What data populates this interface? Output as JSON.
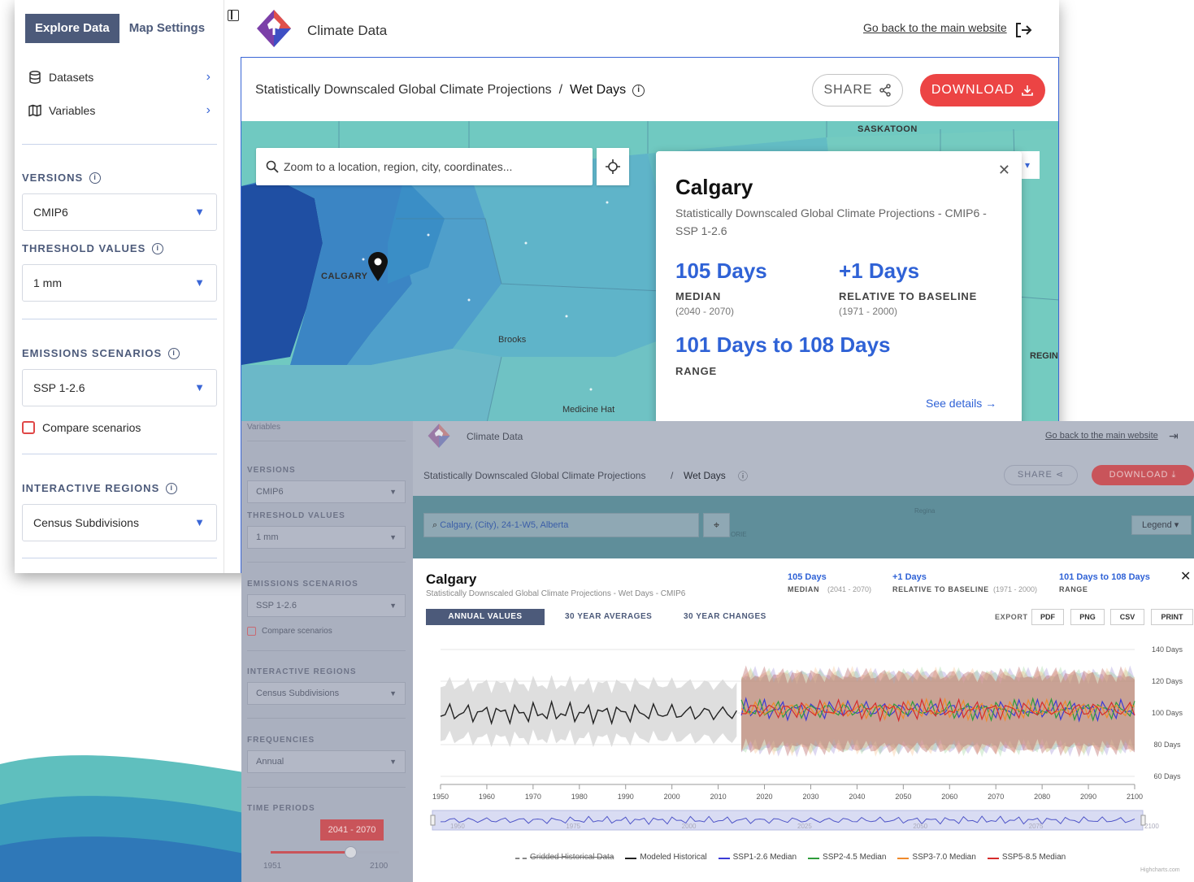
{
  "colors": {
    "brand": "#4c5a7a",
    "accent": "#3a66d6",
    "download": "#ec4444",
    "value_blue": "#2f62d6",
    "map_teal": "#6fc6c0"
  },
  "front": {
    "sidebar": {
      "tabs": [
        "Explore Data",
        "Map Settings"
      ],
      "nav": [
        {
          "label": "Datasets",
          "icon": "database-icon"
        },
        {
          "label": "Variables",
          "icon": "map-icon"
        }
      ],
      "versions_label": "VERSIONS",
      "versions_value": "CMIP6",
      "threshold_label": "THRESHOLD VALUES",
      "threshold_value": "1 mm",
      "emissions_label": "EMISSIONS SCENARIOS",
      "emissions_value": "SSP 1-2.6",
      "compare_label": "Compare scenarios",
      "regions_label": "INTERACTIVE REGIONS",
      "regions_value": "Census Subdivisions"
    },
    "header": {
      "app_title": "Climate Data",
      "back_link": "Go back to the main website"
    },
    "breadcrumb": {
      "dataset": "Statistically Downscaled Global Climate Projections",
      "separator": "/",
      "variable": "Wet Days"
    },
    "share_label": "SHARE",
    "download_label": "DOWNLOAD",
    "map": {
      "search_placeholder": "Zoom to a location, region, city, coordinates...",
      "labels": {
        "saskatoon": "SASKATOON",
        "calgary": "CALGARY",
        "brooks": "Brooks",
        "medicine_hat": "Medicine Hat",
        "regina": "REGIN"
      }
    },
    "popup": {
      "city": "Calgary",
      "subtitle": "Statistically Downscaled Global Climate Projections - CMIP6 - SSP 1-2.6",
      "median_value": "105 Days",
      "median_label": "MEDIAN",
      "median_period": "(2040 - 2070)",
      "relative_value": "+1 Days",
      "relative_label": "RELATIVE TO BASELINE",
      "relative_period": "(1971 - 2000)",
      "range_value": "101 Days to 108 Days",
      "range_label": "RANGE",
      "see_details": "See details"
    }
  },
  "back": {
    "sidebar": {
      "variables": "Variables",
      "versions_label": "VERSIONS",
      "versions_value": "CMIP6",
      "threshold_label": "THRESHOLD VALUES",
      "threshold_value": "1 mm",
      "emissions_label": "EMISSIONS SCENARIOS",
      "emissions_value": "SSP 1-2.6",
      "compare_label": "Compare scenarios",
      "regions_label": "INTERACTIVE REGIONS",
      "regions_value": "Census Subdivisions",
      "frequencies_label": "FREQUENCIES",
      "frequencies_value": "Annual",
      "periods_label": "TIME PERIODS",
      "period_badge": "2041 - 2070",
      "period_min": "1951",
      "period_max": "2100",
      "period_position": 0.62
    },
    "header": {
      "app_title": "Climate Data",
      "back_link": "Go back to the main website",
      "dataset": "Statistically Downscaled Global Climate Projections",
      "separator": "/",
      "variable": "Wet Days",
      "share": "SHARE",
      "download": "DOWNLOAD"
    },
    "map": {
      "search_value": "Calgary, (City), 24-1-W5, Alberta",
      "legend": "Legend",
      "label_a": "Regina",
      "label_b": "ORIE"
    },
    "detail": {
      "city": "Calgary",
      "subtitle": "Statistically Downscaled Global Climate Projections - Wet Days - CMIP6",
      "median_value": "105 Days",
      "median_label": "MEDIAN",
      "median_period": "(2041 - 2070)",
      "relative_value": "+1 Days",
      "relative_label": "RELATIVE TO BASELINE",
      "relative_period": "(1971 - 2000)",
      "range_value": "101 Days to 108 Days",
      "range_label": "RANGE",
      "tabs": [
        "ANNUAL VALUES",
        "30 YEAR AVERAGES",
        "30 YEAR CHANGES"
      ],
      "export_label": "EXPORT",
      "export_buttons": [
        "PDF",
        "PNG",
        "CSV",
        "PRINT"
      ],
      "credit": "Highcharts.com"
    }
  },
  "chart_data": {
    "type": "line",
    "title": "",
    "xlabel": "",
    "ylabel": "",
    "xlim": [
      1950,
      2100
    ],
    "ylim": [
      60,
      140
    ],
    "x_ticks": [
      "1950",
      "1960",
      "1970",
      "1980",
      "1990",
      "2000",
      "2010",
      "2020",
      "2030",
      "2040",
      "2050",
      "2060",
      "2070",
      "2080",
      "2090",
      "2100"
    ],
    "y_ticks": [
      "140 Days",
      "120 Days",
      "100 Days",
      "80 Days",
      "60 Days"
    ],
    "navigator_ticks": [
      "1950",
      "1975",
      "2000",
      "2025",
      "2050",
      "2075",
      "2100"
    ],
    "series": [
      {
        "name": "Gridded Historical Data",
        "color": "#888888",
        "style": "dashed",
        "values": []
      },
      {
        "name": "Modeled Historical",
        "color": "#222222",
        "x_range": [
          1950,
          2014
        ],
        "median": 100,
        "band": [
          84,
          118
        ]
      },
      {
        "name": "SSP1-2.6 Median",
        "color": "#3b3bd6",
        "x_range": [
          2015,
          2100
        ],
        "median": 102,
        "band": [
          78,
          124
        ]
      },
      {
        "name": "SSP2-4.5 Median",
        "color": "#2e9c3a",
        "x_range": [
          2015,
          2100
        ],
        "median": 102,
        "band": [
          78,
          124
        ]
      },
      {
        "name": "SSP3-7.0 Median",
        "color": "#f08a2c",
        "x_range": [
          2015,
          2100
        ],
        "median": 102,
        "band": [
          78,
          124
        ]
      },
      {
        "name": "SSP5-8.5 Median",
        "color": "#d62c2c",
        "x_range": [
          2015,
          2100
        ],
        "median": 102,
        "band": [
          78,
          124
        ]
      }
    ]
  }
}
